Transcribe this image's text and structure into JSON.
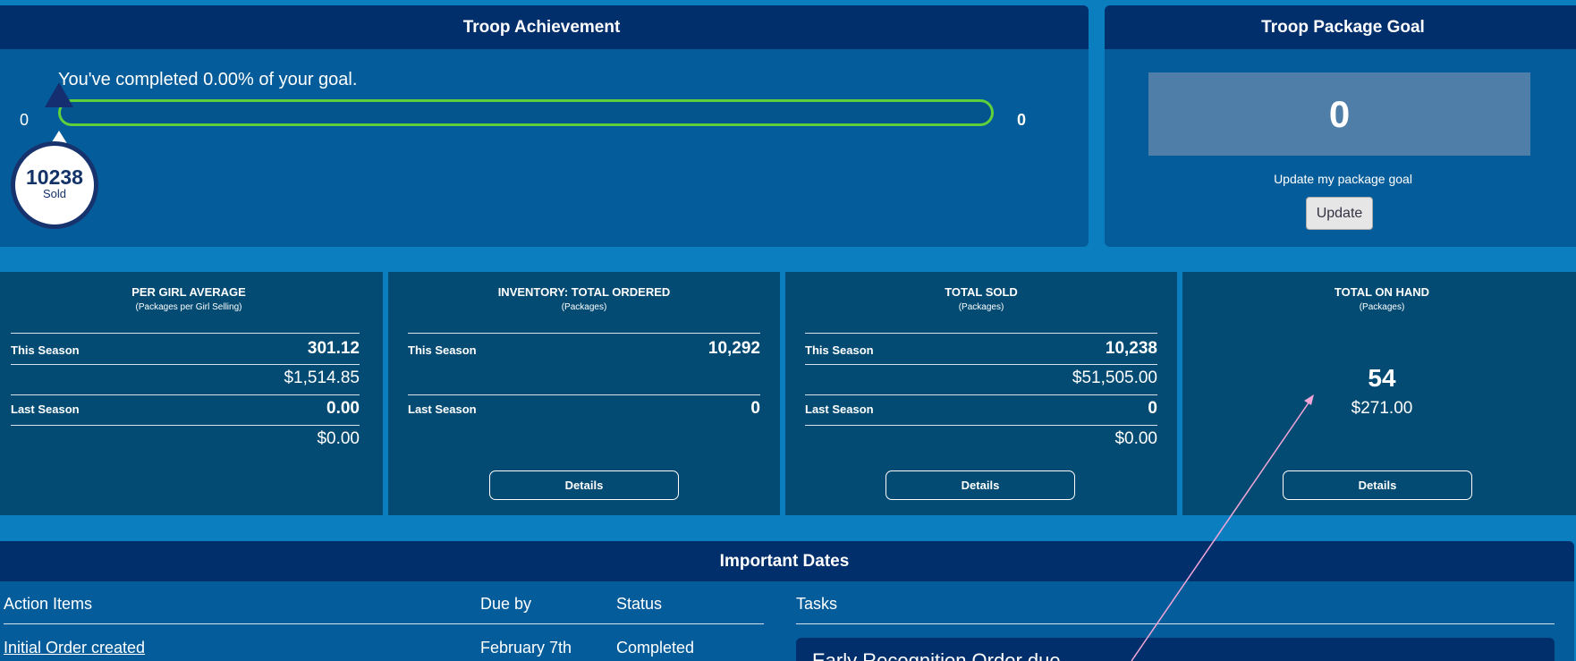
{
  "achievement": {
    "title": "Troop Achievement",
    "message": "You've completed 0.00% of your goal.",
    "bar_min": "0",
    "bar_max": "0",
    "progress_fraction": 0,
    "sold_count": "10238",
    "sold_label": "Sold"
  },
  "package_goal": {
    "title": "Troop Package Goal",
    "value": "0",
    "label": "Update my package goal",
    "button": "Update"
  },
  "stats": [
    {
      "title": "PER GIRL AVERAGE",
      "subtitle": "(Packages per Girl Selling)",
      "this_label": "This Season",
      "this_value": "301.12",
      "this_amount": "$1,514.85",
      "last_label": "Last Season",
      "last_value": "0.00",
      "last_amount": "$0.00"
    },
    {
      "title": "INVENTORY: TOTAL ORDERED",
      "subtitle": "(Packages)",
      "this_label": "This Season",
      "this_value": "10,292",
      "last_label": "Last Season",
      "last_value": "0",
      "button": "Details"
    },
    {
      "title": "TOTAL SOLD",
      "subtitle": "(Packages)",
      "this_label": "This Season",
      "this_value": "10,238",
      "this_amount": "$51,505.00",
      "last_label": "Last Season",
      "last_value": "0",
      "last_amount": "$0.00",
      "button": "Details"
    },
    {
      "title": "TOTAL ON HAND",
      "subtitle": "(Packages)",
      "value": "54",
      "amount": "$271.00",
      "button": "Details"
    }
  ],
  "dates": {
    "title": "Important Dates",
    "headers": {
      "action_items": "Action Items",
      "due_by": "Due by",
      "status": "Status",
      "tasks": "Tasks"
    },
    "rows": [
      {
        "item": "Initial Order created",
        "due": "February 7th",
        "status": "Completed"
      }
    ],
    "task_card": "Early Recognition Order due"
  },
  "colors": {
    "background": "#0b7ec0",
    "panel": "#045d9a",
    "header": "#012f6c",
    "stat_tile": "#044b73",
    "progress_green": "#5fcf3a",
    "annotation_pink": "#f2a6d8"
  }
}
